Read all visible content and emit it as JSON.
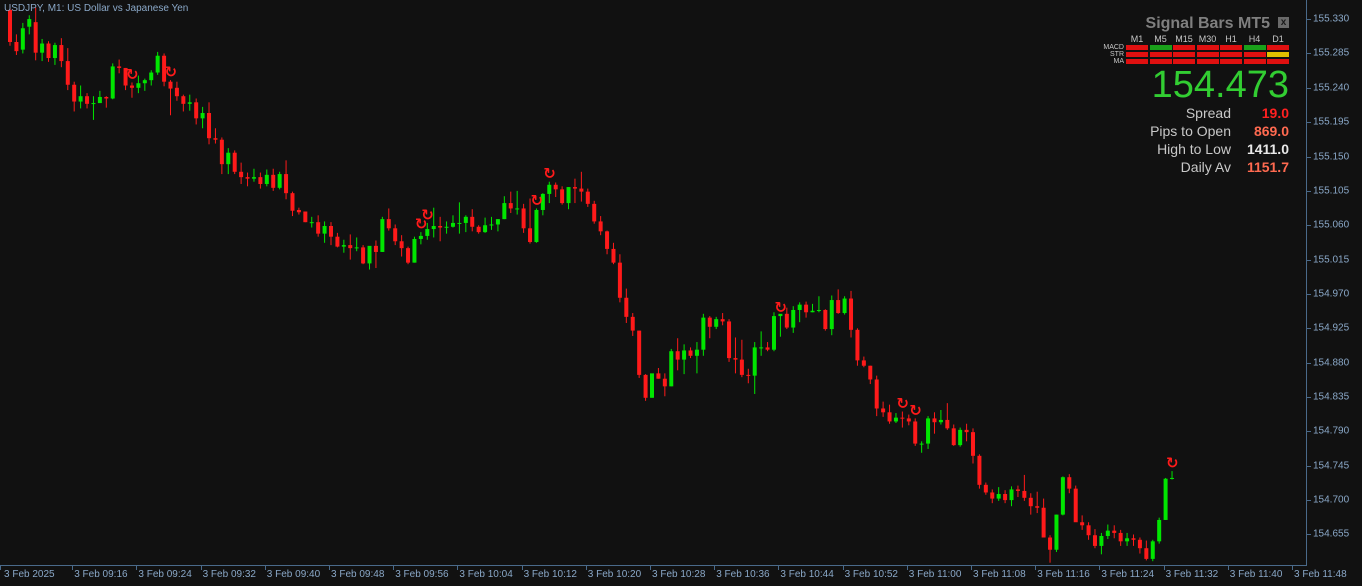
{
  "window": {
    "title": "USDJPY, M1:  US Dollar vs Japanese Yen"
  },
  "colors": {
    "background": "#111111",
    "bull": "#00e600",
    "bear": "#ff1a1a",
    "axis_text": "#8aa8c8",
    "signal_arrow": "#ff1a1a"
  },
  "panel": {
    "title": "Signal Bars MT5",
    "close_glyph": "x",
    "timeframes": [
      "M1",
      "M5",
      "M15",
      "M30",
      "H1",
      "H4",
      "D1"
    ],
    "indicators": [
      {
        "name": "MACD",
        "signals": [
          "red",
          "green",
          "red",
          "red",
          "red",
          "green",
          "red"
        ]
      },
      {
        "name": "STR",
        "signals": [
          "red",
          "red",
          "red",
          "red",
          "red",
          "red",
          "yellow"
        ]
      },
      {
        "name": "MA",
        "signals": [
          "red",
          "red",
          "red",
          "red",
          "red",
          "red",
          "red"
        ]
      }
    ],
    "signal_colors": {
      "red": "#e01010",
      "green": "#1aa01a",
      "yellow": "#e0c000"
    },
    "price": "154.473",
    "stats": [
      {
        "label": "Spread",
        "value": "19.0",
        "color": "#ff2020"
      },
      {
        "label": "Pips to Open",
        "value": "869.0",
        "color": "#ff6a50"
      },
      {
        "label": "High to Low",
        "value": "1411.0",
        "color": "#e8e8e8"
      },
      {
        "label": "Daily Av",
        "value": "1151.7",
        "color": "#ff6a50"
      }
    ]
  },
  "price_axis": {
    "labels": [
      "155.330",
      "155.285",
      "155.240",
      "155.195",
      "155.150",
      "155.105",
      "155.060",
      "155.015",
      "154.970",
      "154.925",
      "154.880",
      "154.835",
      "154.790",
      "154.745",
      "154.700",
      "154.655"
    ]
  },
  "time_axis": {
    "labels": [
      "3 Feb 2025",
      "3 Feb 09:16",
      "3 Feb 09:24",
      "3 Feb 09:32",
      "3 Feb 09:40",
      "3 Feb 09:48",
      "3 Feb 09:56",
      "3 Feb 10:04",
      "3 Feb 10:12",
      "3 Feb 10:20",
      "3 Feb 10:28",
      "3 Feb 10:36",
      "3 Feb 10:44",
      "3 Feb 10:52",
      "3 Feb 11:00",
      "3 Feb 11:08",
      "3 Feb 11:16",
      "3 Feb 11:24",
      "3 Feb 11:32",
      "3 Feb 11:40",
      "3 Feb 11:48"
    ]
  },
  "chart_data": {
    "type": "candlestick",
    "symbol": "USDJPY",
    "timeframe": "M1",
    "ylim": [
      154.615,
      155.355
    ],
    "candles": [
      [
        155.342,
        155.349,
        155.295,
        155.3
      ],
      [
        155.3,
        155.31,
        155.283,
        155.288
      ],
      [
        155.29,
        155.325,
        155.285,
        155.318
      ],
      [
        155.32,
        155.335,
        155.31,
        155.33
      ],
      [
        155.326,
        155.345,
        155.276,
        155.286
      ],
      [
        155.286,
        155.304,
        155.275,
        155.298
      ],
      [
        155.298,
        155.301,
        155.274,
        155.279
      ],
      [
        155.279,
        155.299,
        155.27,
        155.296
      ],
      [
        155.296,
        155.305,
        155.267,
        155.275
      ],
      [
        155.275,
        155.292,
        155.237,
        155.244
      ],
      [
        155.244,
        155.248,
        155.209,
        155.222
      ],
      [
        155.222,
        155.243,
        155.213,
        155.229
      ],
      [
        155.229,
        155.233,
        155.213,
        155.219
      ],
      [
        155.22,
        155.229,
        155.198,
        155.22
      ],
      [
        155.22,
        155.236,
        155.22,
        155.228
      ],
      [
        155.228,
        155.229,
        155.214,
        155.226
      ],
      [
        155.226,
        155.272,
        155.225,
        155.268
      ],
      [
        155.268,
        155.277,
        155.259,
        155.266
      ],
      [
        155.266,
        155.266,
        155.237,
        155.243
      ],
      [
        155.243,
        155.247,
        155.227,
        155.24
      ],
      [
        155.24,
        155.256,
        155.233,
        155.246
      ],
      [
        155.246,
        155.252,
        155.236,
        155.25
      ],
      [
        155.25,
        155.263,
        155.243,
        155.26
      ],
      [
        155.26,
        155.287,
        155.257,
        155.282
      ],
      [
        155.282,
        155.285,
        155.242,
        155.248
      ],
      [
        155.248,
        155.25,
        155.204,
        155.239
      ],
      [
        155.24,
        155.248,
        155.223,
        155.229
      ],
      [
        155.229,
        155.231,
        155.209,
        155.219
      ],
      [
        155.219,
        155.231,
        155.21,
        155.221
      ],
      [
        155.221,
        155.226,
        155.192,
        155.2
      ],
      [
        155.2,
        155.215,
        155.187,
        155.207
      ],
      [
        155.207,
        155.221,
        155.166,
        155.174
      ],
      [
        155.174,
        155.187,
        155.167,
        155.172
      ],
      [
        155.172,
        155.175,
        155.127,
        155.14
      ],
      [
        155.14,
        155.161,
        155.127,
        155.155
      ],
      [
        155.155,
        155.158,
        155.127,
        155.13
      ],
      [
        155.13,
        155.142,
        155.114,
        155.123
      ],
      [
        155.123,
        155.129,
        155.111,
        155.121
      ],
      [
        155.121,
        155.134,
        155.117,
        155.123
      ],
      [
        155.123,
        155.129,
        155.108,
        155.114
      ],
      [
        155.114,
        155.133,
        155.111,
        155.126
      ],
      [
        155.126,
        155.134,
        155.105,
        155.109
      ],
      [
        155.109,
        155.13,
        155.107,
        155.127
      ],
      [
        155.127,
        155.145,
        155.094,
        155.102
      ],
      [
        155.102,
        155.104,
        155.072,
        155.079
      ],
      [
        155.08,
        155.083,
        155.074,
        155.077
      ],
      [
        155.078,
        155.078,
        155.064,
        155.064
      ],
      [
        155.064,
        155.071,
        155.057,
        155.064
      ],
      [
        155.064,
        155.073,
        155.045,
        155.049
      ],
      [
        155.049,
        155.065,
        155.037,
        155.059
      ],
      [
        155.059,
        155.064,
        155.034,
        155.045
      ],
      [
        155.045,
        155.05,
        155.031,
        155.032
      ],
      [
        155.032,
        155.041,
        155.024,
        155.034
      ],
      [
        155.034,
        155.048,
        155.015,
        155.03
      ],
      [
        155.03,
        155.044,
        155.026,
        155.031
      ],
      [
        155.031,
        155.034,
        155.009,
        155.01
      ],
      [
        155.01,
        155.032,
        155.002,
        155.033
      ],
      [
        155.033,
        155.04,
        155.004,
        155.025
      ],
      [
        155.025,
        155.071,
        155.025,
        155.068
      ],
      [
        155.068,
        155.082,
        155.053,
        155.056
      ],
      [
        155.056,
        155.061,
        155.034,
        155.039
      ],
      [
        155.039,
        155.047,
        155.019,
        155.03
      ],
      [
        155.03,
        155.032,
        155.009,
        155.011
      ],
      [
        155.011,
        155.045,
        155.011,
        155.042
      ],
      [
        155.042,
        155.051,
        155.035,
        155.046
      ],
      [
        155.046,
        155.063,
        155.041,
        155.055
      ],
      [
        155.055,
        155.083,
        155.044,
        155.059
      ],
      [
        155.059,
        155.071,
        155.039,
        155.057
      ],
      [
        155.057,
        155.065,
        155.049,
        155.058
      ],
      [
        155.058,
        155.073,
        155.057,
        155.063
      ],
      [
        155.063,
        155.09,
        155.049,
        155.063
      ],
      [
        155.063,
        155.073,
        155.051,
        155.071
      ],
      [
        155.071,
        155.081,
        155.052,
        155.058
      ],
      [
        155.058,
        155.06,
        155.049,
        155.051
      ],
      [
        155.051,
        155.07,
        155.05,
        155.06
      ],
      [
        155.06,
        155.071,
        155.054,
        155.061
      ],
      [
        155.061,
        155.068,
        155.052,
        155.068
      ],
      [
        155.068,
        155.098,
        155.068,
        155.089
      ],
      [
        155.089,
        155.104,
        155.076,
        155.082
      ],
      [
        155.082,
        155.105,
        155.074,
        155.082
      ],
      [
        155.082,
        155.088,
        155.05,
        155.056
      ],
      [
        155.056,
        155.095,
        155.036,
        155.038
      ],
      [
        155.038,
        155.082,
        155.037,
        155.08
      ],
      [
        155.08,
        155.102,
        155.073,
        155.101
      ],
      [
        155.101,
        155.117,
        155.089,
        155.113
      ],
      [
        155.113,
        155.116,
        155.097,
        155.107
      ],
      [
        155.107,
        155.111,
        155.087,
        155.089
      ],
      [
        155.089,
        155.11,
        155.081,
        155.11
      ],
      [
        155.11,
        155.121,
        155.089,
        155.108
      ],
      [
        155.108,
        155.13,
        155.091,
        155.104
      ],
      [
        155.104,
        155.108,
        155.084,
        155.088
      ],
      [
        155.088,
        155.092,
        155.062,
        155.065
      ],
      [
        155.065,
        155.072,
        155.047,
        155.052
      ],
      [
        155.052,
        155.053,
        155.022,
        155.029
      ],
      [
        155.029,
        155.037,
        155.009,
        155.011
      ],
      [
        155.011,
        155.022,
        154.959,
        154.965
      ],
      [
        154.965,
        154.977,
        154.932,
        154.94
      ],
      [
        154.94,
        154.945,
        154.915,
        154.922
      ],
      [
        154.922,
        154.922,
        154.86,
        154.864
      ],
      [
        154.864,
        154.865,
        154.83,
        154.834
      ],
      [
        154.834,
        154.865,
        154.834,
        154.866
      ],
      [
        154.866,
        154.873,
        154.859,
        154.859
      ],
      [
        154.859,
        154.866,
        154.836,
        154.849
      ],
      [
        154.849,
        154.898,
        154.849,
        154.895
      ],
      [
        154.895,
        154.912,
        154.87,
        154.884
      ],
      [
        154.884,
        154.904,
        154.865,
        154.896
      ],
      [
        154.896,
        154.9,
        154.886,
        154.889
      ],
      [
        154.889,
        154.907,
        154.866,
        154.897
      ],
      [
        154.897,
        154.944,
        154.889,
        154.939
      ],
      [
        154.939,
        154.941,
        154.912,
        154.927
      ],
      [
        154.927,
        154.94,
        154.924,
        154.937
      ],
      [
        154.937,
        154.945,
        154.929,
        154.934
      ],
      [
        154.934,
        154.937,
        154.881,
        154.886
      ],
      [
        154.886,
        154.913,
        154.866,
        154.884
      ],
      [
        154.884,
        154.91,
        154.861,
        154.864
      ],
      [
        154.864,
        154.872,
        154.853,
        154.863
      ],
      [
        154.863,
        154.907,
        154.839,
        154.9
      ],
      [
        154.9,
        154.921,
        154.889,
        154.9
      ],
      [
        154.9,
        154.907,
        154.895,
        154.897
      ],
      [
        154.897,
        154.946,
        154.895,
        154.941
      ],
      [
        154.941,
        154.942,
        154.914,
        154.944
      ],
      [
        154.944,
        154.952,
        154.924,
        154.926
      ],
      [
        154.926,
        154.954,
        154.919,
        154.949
      ],
      [
        154.949,
        154.959,
        154.933,
        154.956
      ],
      [
        154.956,
        154.96,
        154.939,
        154.946
      ],
      [
        154.946,
        154.957,
        154.946,
        154.948
      ],
      [
        154.948,
        154.967,
        154.946,
        154.949
      ],
      [
        154.949,
        154.95,
        154.922,
        154.924
      ],
      [
        154.924,
        154.968,
        154.916,
        154.962
      ],
      [
        154.962,
        154.976,
        154.944,
        154.945
      ],
      [
        154.945,
        154.967,
        154.943,
        154.964
      ],
      [
        154.964,
        154.974,
        154.913,
        154.923
      ],
      [
        154.923,
        154.925,
        154.876,
        154.883
      ],
      [
        154.883,
        154.888,
        154.874,
        154.876
      ],
      [
        154.876,
        154.876,
        154.852,
        154.858
      ],
      [
        154.858,
        154.863,
        154.81,
        154.82
      ],
      [
        154.82,
        154.829,
        154.809,
        154.815
      ],
      [
        154.815,
        154.825,
        154.8,
        154.803
      ],
      [
        154.803,
        154.814,
        154.801,
        154.808
      ],
      [
        154.808,
        154.816,
        154.795,
        154.807
      ],
      [
        154.807,
        154.812,
        154.798,
        154.803
      ],
      [
        154.803,
        154.807,
        154.771,
        154.774
      ],
      [
        154.774,
        154.777,
        154.762,
        154.774
      ],
      [
        154.774,
        154.81,
        154.767,
        154.807
      ],
      [
        154.807,
        154.815,
        154.787,
        154.802
      ],
      [
        154.802,
        154.818,
        154.799,
        154.805
      ],
      [
        154.805,
        154.827,
        154.792,
        154.794
      ],
      [
        154.794,
        154.799,
        154.771,
        154.772
      ],
      [
        154.772,
        154.795,
        154.77,
        154.792
      ],
      [
        154.792,
        154.8,
        154.777,
        154.789
      ],
      [
        154.789,
        154.794,
        154.748,
        154.758
      ],
      [
        154.758,
        154.76,
        154.715,
        154.72
      ],
      [
        154.72,
        154.723,
        154.707,
        154.71
      ],
      [
        154.71,
        154.714,
        154.696,
        154.702
      ],
      [
        154.702,
        154.717,
        154.699,
        154.708
      ],
      [
        154.708,
        154.713,
        154.696,
        154.7
      ],
      [
        154.7,
        154.718,
        154.692,
        154.714
      ],
      [
        154.714,
        154.719,
        154.704,
        154.712
      ],
      [
        154.712,
        154.733,
        154.699,
        154.703
      ],
      [
        154.703,
        154.709,
        154.681,
        154.692
      ],
      [
        154.692,
        154.711,
        154.683,
        154.69
      ],
      [
        154.69,
        154.702,
        154.651,
        154.651
      ],
      [
        154.651,
        154.654,
        154.618,
        154.635
      ],
      [
        154.635,
        154.681,
        154.632,
        154.681
      ],
      [
        154.681,
        154.731,
        154.68,
        154.73
      ],
      [
        154.73,
        154.734,
        154.709,
        154.715
      ],
      [
        154.715,
        154.719,
        154.672,
        154.671
      ],
      [
        154.671,
        154.68,
        154.661,
        154.667
      ],
      [
        154.667,
        154.671,
        154.648,
        154.654
      ],
      [
        154.654,
        154.662,
        154.637,
        154.64
      ],
      [
        154.64,
        154.657,
        154.629,
        154.653
      ],
      [
        154.653,
        154.668,
        154.649,
        154.66
      ],
      [
        154.66,
        154.667,
        154.65,
        154.657
      ],
      [
        154.657,
        154.661,
        154.64,
        154.646
      ],
      [
        154.646,
        154.657,
        154.64,
        154.65
      ],
      [
        154.65,
        154.655,
        154.64,
        154.648
      ],
      [
        154.648,
        154.651,
        154.63,
        154.637
      ],
      [
        154.637,
        154.647,
        154.621,
        154.623
      ],
      [
        154.623,
        154.648,
        154.62,
        154.646
      ],
      [
        154.646,
        154.677,
        154.643,
        154.674
      ],
      [
        154.674,
        154.729,
        154.674,
        154.728
      ],
      [
        154.728,
        154.738,
        154.727,
        154.729
      ]
    ],
    "signals": [
      19,
      25,
      64,
      65,
      82,
      84,
      120,
      139,
      141,
      181
    ]
  }
}
